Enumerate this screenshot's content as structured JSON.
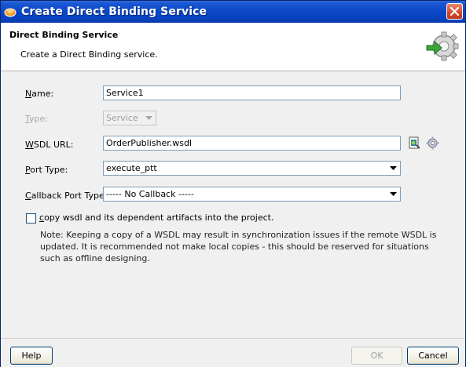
{
  "window": {
    "title": "Create Direct Binding Service"
  },
  "header": {
    "title": "Direct Binding Service",
    "subtitle": "Create a Direct Binding service."
  },
  "form": {
    "name": {
      "label_u": "N",
      "label_rest": "ame:",
      "value": "Service1"
    },
    "type": {
      "label_u": "T",
      "label_rest": "ype:",
      "value": "Service"
    },
    "wsdl": {
      "label_u": "W",
      "label_rest": "SDL URL:",
      "value": "OrderPublisher.wsdl"
    },
    "port_type": {
      "label_u": "P",
      "label_rest": "ort Type:",
      "value": "execute_ptt"
    },
    "callback": {
      "label_u": "C",
      "label_rest": "allback Port Type:",
      "value": "----- No Callback -----"
    },
    "copy_wsdl": {
      "label_u": "c",
      "label_rest": "opy wsdl and its dependent artifacts into the project.",
      "checked": false
    },
    "note": "Note: Keeping a copy of a WSDL may result in synchronization issues if the remote WSDL is updated. It is recommended not make local copies - this should be reserved for situations such as offline designing."
  },
  "buttons": {
    "help": "Help",
    "ok": "OK",
    "cancel": "Cancel"
  },
  "icons": {
    "title": "service-icon",
    "header": "gear-arrow-icon",
    "wsdl_browse": "find-wsdl-icon",
    "wsdl_config": "gear-icon",
    "close": "close-icon"
  }
}
